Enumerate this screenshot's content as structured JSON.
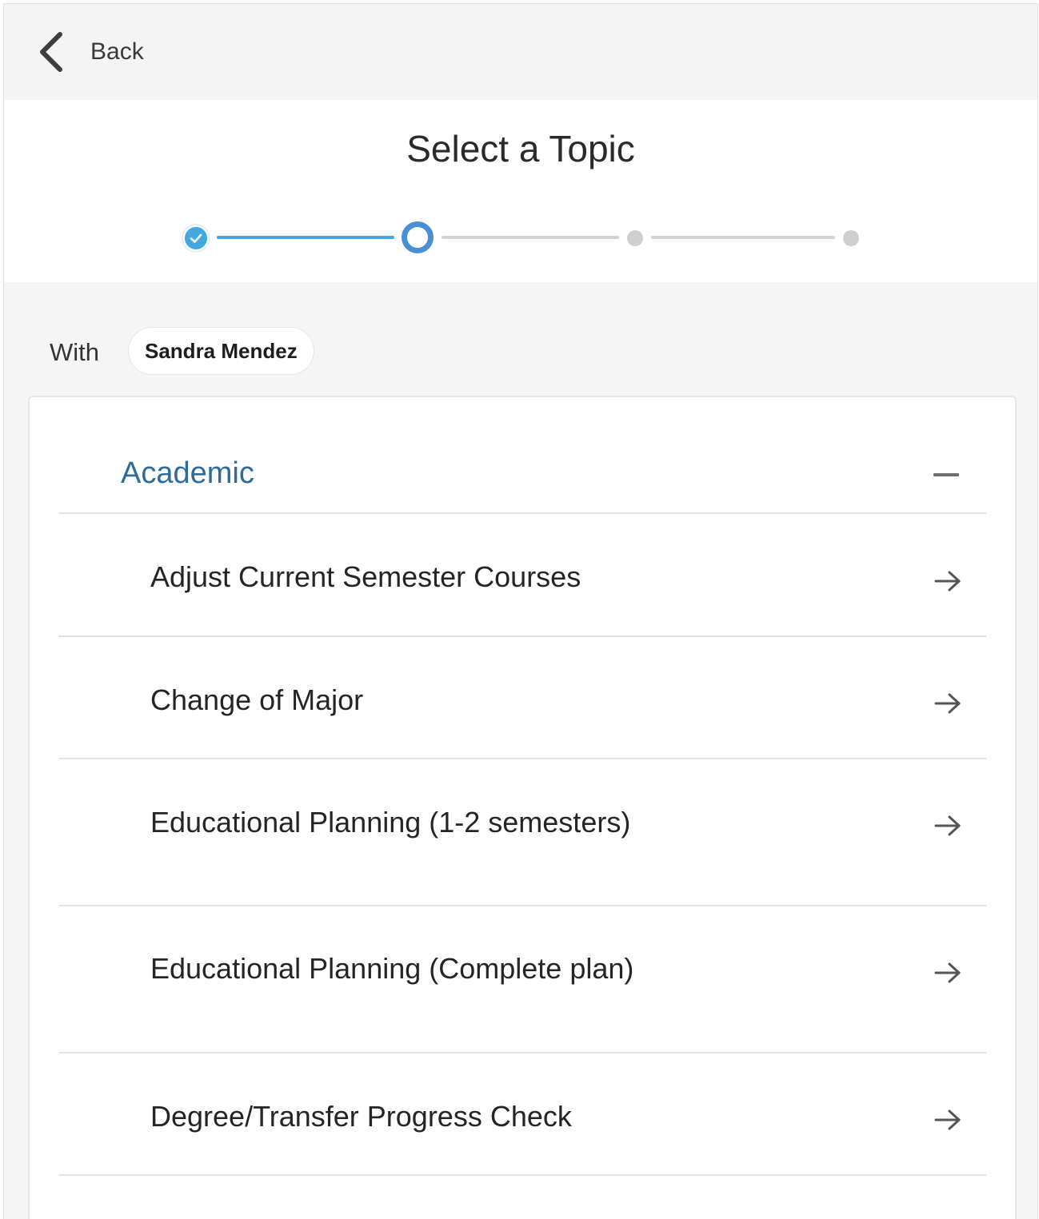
{
  "topbar": {
    "back_label": "Back",
    "back_icon": "chevron-left-icon"
  },
  "header": {
    "title": "Select a Topic"
  },
  "stepper": {
    "steps": [
      {
        "state": "completed"
      },
      {
        "state": "current"
      },
      {
        "state": "pending"
      },
      {
        "state": "pending"
      }
    ],
    "colors": {
      "done": "#41a9e0",
      "current": "#4a8fd6",
      "pending": "#cfcfcf"
    }
  },
  "with_row": {
    "label": "With",
    "person": "Sandra Mendez"
  },
  "section": {
    "title": "Academic",
    "expanded": true,
    "title_color": "#2f6b9a",
    "topics": [
      {
        "label": "Adjust Current Semester Courses",
        "icon": "arrow-right-icon"
      },
      {
        "label": "Change of Major",
        "icon": "arrow-right-icon"
      },
      {
        "label": "Educational Planning (1-2 semesters)",
        "icon": "arrow-right-icon"
      },
      {
        "label": "Educational Planning (Complete plan)",
        "icon": "arrow-right-icon"
      },
      {
        "label": "Degree/Transfer Progress Check",
        "icon": "arrow-right-icon"
      }
    ]
  }
}
